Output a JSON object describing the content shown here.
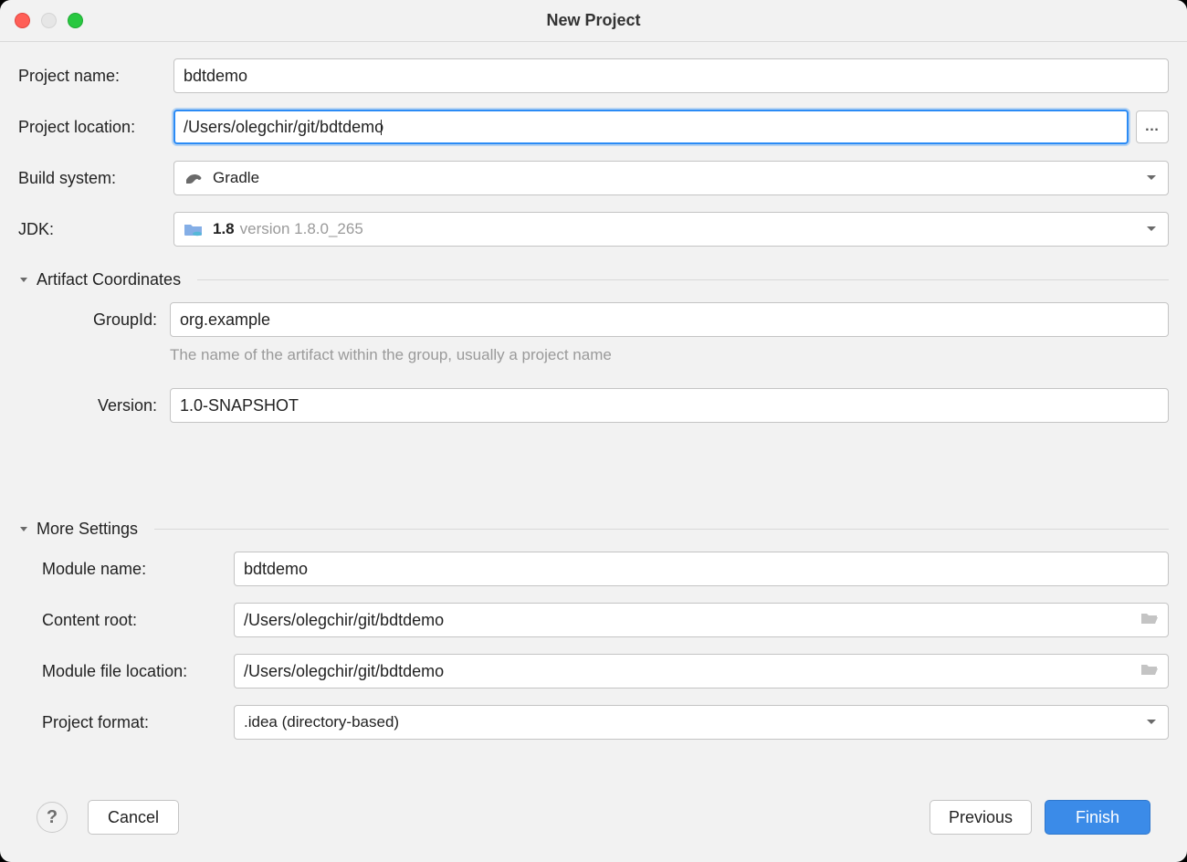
{
  "window": {
    "title": "New Project"
  },
  "form": {
    "project_name": {
      "label": "Project name:",
      "value": "bdtdemo"
    },
    "project_location": {
      "label": "Project location:",
      "value": "/Users/olegchir/git/bdtdemo",
      "browse": "…"
    },
    "build_system": {
      "label": "Build system:",
      "value": "Gradle"
    },
    "jdk": {
      "label": "JDK:",
      "value": "1.8",
      "version_suffix": "version 1.8.0_265"
    }
  },
  "artifact": {
    "section_title": "Artifact Coordinates",
    "group_id": {
      "label": "GroupId:",
      "value": "org.example"
    },
    "hint": "The name of the artifact within the group, usually a project name",
    "version": {
      "label": "Version:",
      "value": "1.0-SNAPSHOT"
    }
  },
  "more": {
    "section_title": "More Settings",
    "module_name": {
      "label": "Module name:",
      "value": "bdtdemo"
    },
    "content_root": {
      "label": "Content root:",
      "value": "/Users/olegchir/git/bdtdemo"
    },
    "module_file_location": {
      "label": "Module file location:",
      "value": "/Users/olegchir/git/bdtdemo"
    },
    "project_format": {
      "label": "Project format:",
      "value": ".idea (directory-based)"
    }
  },
  "footer": {
    "cancel": "Cancel",
    "previous": "Previous",
    "finish": "Finish",
    "help": "?"
  }
}
